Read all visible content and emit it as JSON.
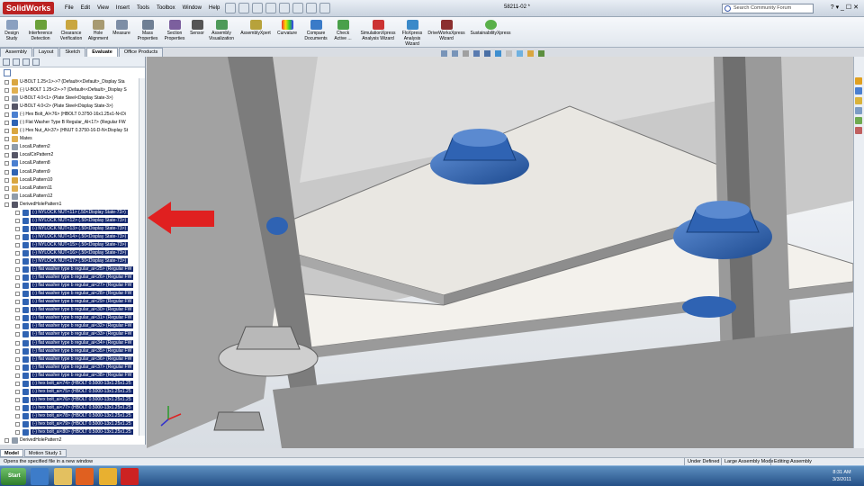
{
  "app": {
    "logo": "SolidWorks",
    "document_title": "58211-02 *",
    "window_controls": "? ▾ _ ☐ ✕"
  },
  "menu": [
    "File",
    "Edit",
    "View",
    "Insert",
    "Tools",
    "Toolbox",
    "Window",
    "Help"
  ],
  "search": {
    "placeholder": "Search Community Forum"
  },
  "commands": [
    {
      "label": "Design Study"
    },
    {
      "label": "Interference Detection"
    },
    {
      "label": "Clearance Verification"
    },
    {
      "label": "Hole Alignment"
    },
    {
      "label": "Measure"
    },
    {
      "label": "Mass Properties"
    },
    {
      "label": "Section Properties"
    },
    {
      "label": "Sensor"
    },
    {
      "label": "Assembly Visualization"
    },
    {
      "label": "AssemblyXpert"
    },
    {
      "label": "Curvature"
    },
    {
      "label": "Compare Documents"
    },
    {
      "label": "Check Active ..."
    },
    {
      "label": "SimulationXpress Analysis Wizard"
    },
    {
      "label": "FloXpress Analysis Wizard"
    },
    {
      "label": "DriveWorksXpress Wizard"
    },
    {
      "label": "SustainabilityXpress"
    }
  ],
  "tabs": [
    "Assembly",
    "Layout",
    "Sketch",
    "Evaluate",
    "Office Products"
  ],
  "active_tab": "Evaluate",
  "tree": [
    {
      "label": "U-BOLT 1.25<1>->? (Default<<Default>_Display Sta",
      "sel": false,
      "sub": false
    },
    {
      "label": "(-) U-BOLT 1.25<2>->? (Default<<Default>_Display S",
      "sel": false,
      "sub": false
    },
    {
      "label": "U-BOLT 4.0<1> (Plate Steel<Display State-3>)",
      "sel": false,
      "sub": false
    },
    {
      "label": "U-BOLT 4.0<2> (Plate Steel<Display State-3>)",
      "sel": false,
      "sub": false
    },
    {
      "label": "(-) Hex Bolt_AI<76> (HBOLT 0.3750-16x1.25x1-N<Di",
      "sel": false,
      "sub": false
    },
    {
      "label": "(-) Flat Washer Type B Regular_AI<17> (Regular FW",
      "sel": false,
      "sub": false
    },
    {
      "label": "(-) Hex Nut_AI<37> (HNUT 0.3750-16-D-N<Display St",
      "sel": false,
      "sub": false
    },
    {
      "label": "Mates",
      "sel": false,
      "sub": false
    },
    {
      "label": "LocalLPattern2",
      "sel": false,
      "sub": false
    },
    {
      "label": "LocalCirPattern2",
      "sel": false,
      "sub": false
    },
    {
      "label": "LocalLPattern8",
      "sel": false,
      "sub": false
    },
    {
      "label": "LocalLPattern9",
      "sel": false,
      "sub": false
    },
    {
      "label": "LocalLPattern10",
      "sel": false,
      "sub": false
    },
    {
      "label": "LocalLPattern11",
      "sel": false,
      "sub": false
    },
    {
      "label": "LocalLPattern12",
      "sel": false,
      "sub": false
    },
    {
      "label": "DerivedHolePattern1",
      "sel": false,
      "sub": false
    },
    {
      "label": "(-) NYLOCK NUT<11> (.50<Display State-73>)",
      "sel": true,
      "sub": true
    },
    {
      "label": "(-) NYLOCK NUT<12> (.50<Display State-73>)",
      "sel": true,
      "sub": true
    },
    {
      "label": "(-) NYLOCK NUT<13> (.50<Display State-73>)",
      "sel": true,
      "sub": true
    },
    {
      "label": "(-) NYLOCK NUT<14> (.50<Display State-73>)",
      "sel": true,
      "sub": true
    },
    {
      "label": "(-) NYLOCK NUT<15> (.50<Display State-73>)",
      "sel": true,
      "sub": true
    },
    {
      "label": "(-) NYLOCK NUT<16> (.50<Display State-73>)",
      "sel": true,
      "sub": true
    },
    {
      "label": "(-) NYLOCK NUT<17> (.50<Display State-73>)",
      "sel": true,
      "sub": true
    },
    {
      "label": "(-) flat washer type b regular_ai<25> (Regular FW",
      "sel": true,
      "sub": true
    },
    {
      "label": "(-) flat washer type b regular_ai<26> (Regular FW",
      "sel": true,
      "sub": true
    },
    {
      "label": "(-) flat washer type b regular_ai<27> (Regular FW",
      "sel": true,
      "sub": true
    },
    {
      "label": "(-) flat washer type b regular_ai<28> (Regular FW",
      "sel": true,
      "sub": true
    },
    {
      "label": "(-) flat washer type b regular_ai<29> (Regular FW",
      "sel": true,
      "sub": true
    },
    {
      "label": "(-) flat washer type b regular_ai<30> (Regular FW",
      "sel": true,
      "sub": true
    },
    {
      "label": "(-) flat washer type b regular_ai<31> (Regular FW",
      "sel": true,
      "sub": true
    },
    {
      "label": "(-) flat washer type b regular_ai<32> (Regular FW",
      "sel": true,
      "sub": true
    },
    {
      "label": "(-) flat washer type b regular_ai<33> (Regular FW",
      "sel": true,
      "sub": true
    },
    {
      "label": "(-) flat washer type b regular_ai<34> (Regular FW",
      "sel": true,
      "sub": true
    },
    {
      "label": "(-) flat washer type b regular_ai<35> (Regular FW",
      "sel": true,
      "sub": true
    },
    {
      "label": "(-) flat washer type b regular_ai<36> (Regular FW",
      "sel": true,
      "sub": true
    },
    {
      "label": "(-) flat washer type b regular_ai<37> (Regular FW",
      "sel": true,
      "sub": true
    },
    {
      "label": "(-) flat washer type b regular_ai<38> (Regular FW",
      "sel": true,
      "sub": true
    },
    {
      "label": "(-) hex bolt_ai<74> (HBOLT 0.5000-13x1.25x1.25",
      "sel": true,
      "sub": true
    },
    {
      "label": "(-) hex bolt_ai<75> (HBOLT 0.5000-13x1.25x1.25",
      "sel": true,
      "sub": true
    },
    {
      "label": "(-) hex bolt_ai<76> (HBOLT 0.5000-13x1.25x1.25",
      "sel": true,
      "sub": true
    },
    {
      "label": "(-) hex bolt_ai<77> (HBOLT 0.5000-13x1.25x1.25",
      "sel": true,
      "sub": true
    },
    {
      "label": "(-) hex bolt_ai<78> (HBOLT 0.5000-13x1.25x1.25",
      "sel": true,
      "sub": true
    },
    {
      "label": "(-) hex bolt_ai<79> (HBOLT 0.5000-13x1.25x1.25",
      "sel": true,
      "sub": true
    },
    {
      "label": "(-) hex bolt_ai<80> (HBOLT 0.5000-13x1.25x1.25",
      "sel": true,
      "sub": true
    },
    {
      "label": "DerivedHolePattern2",
      "sel": false,
      "sub": false
    }
  ],
  "bottom_tabs": [
    "Model",
    "Motion Study 1"
  ],
  "status": {
    "message": "Opens the specified file in a new window",
    "cells": [
      "Under Defined",
      "Large Assembly Mode",
      "Editing Assembly"
    ]
  },
  "taskbar": {
    "start": "Start",
    "time": "8:31 AM",
    "date": "3/3/2011"
  },
  "colors": {
    "selection": "#13276e",
    "arrow": "#e02020",
    "hardware": "#2f63b3",
    "plate": "#e9e7e2",
    "frame": "#8f8f8f"
  }
}
